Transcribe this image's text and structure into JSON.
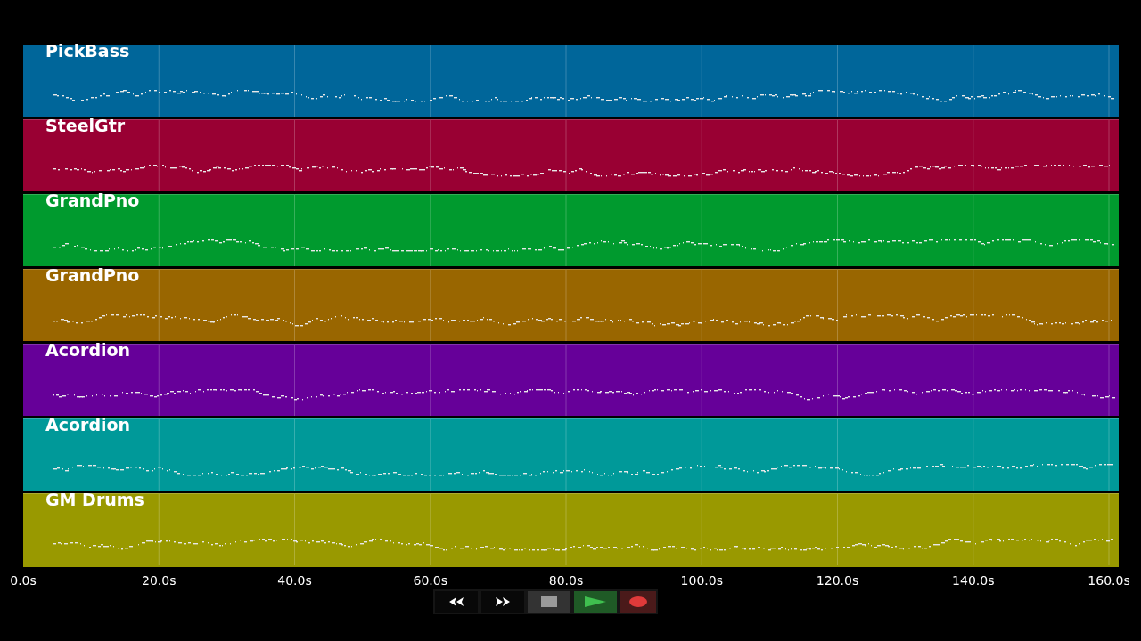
{
  "tracks": [
    {
      "name": "PickBass",
      "color": "#00669a"
    },
    {
      "name": "SteelGtr",
      "color": "#990033"
    },
    {
      "name": "GrandPno",
      "color": "#009a2e"
    },
    {
      "name": "GrandPno",
      "color": "#996600"
    },
    {
      "name": "Acordion",
      "color": "#660099"
    },
    {
      "name": "Acordion",
      "color": "#009999"
    },
    {
      "name": "GM Drums",
      "color": "#999900"
    }
  ],
  "time_axis": {
    "ticks": [
      "0.0s",
      "20.0s",
      "40.0s",
      "60.0s",
      "80.0s",
      "100.0s",
      "120.0s",
      "140.0s",
      "160.0s"
    ]
  },
  "transport": [
    {
      "kind": "rewind"
    },
    {
      "kind": "forward"
    },
    {
      "kind": "stop"
    },
    {
      "kind": "play"
    },
    {
      "kind": "record"
    }
  ]
}
